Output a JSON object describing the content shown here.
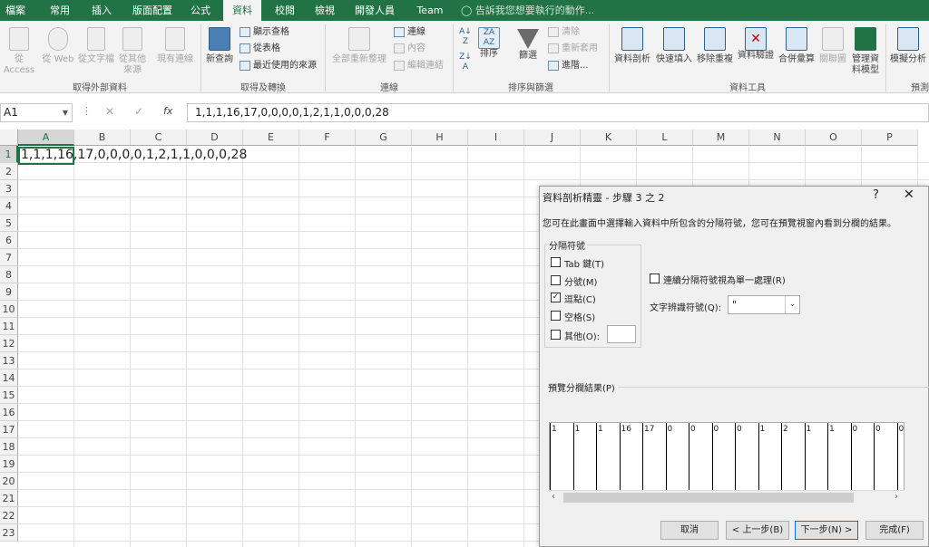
{
  "tabs": [
    "檔案",
    "常用",
    "插入",
    "版面配置",
    "公式",
    "資料",
    "校閱",
    "檢視",
    "開發人員",
    "Team"
  ],
  "active_tab": "資料",
  "tell_me": "告訴我您想要執行的動作...",
  "ribbon": {
    "group_external": {
      "label": "取得外部資料",
      "buttons": [
        "從 Access",
        "從 Web",
        "從文字檔",
        "從其他來源",
        "現有連線"
      ]
    },
    "group_transform": {
      "label": "取得及轉換",
      "new_query": "新查詢",
      "small": [
        "顯示查格",
        "從表格",
        "最近使用的來源"
      ]
    },
    "group_connections": {
      "label": "連線",
      "refresh_all": "全部重新整理",
      "small": [
        "連線",
        "內容",
        "編輯連結"
      ]
    },
    "group_sort": {
      "label": "排序與篩選",
      "sort": "排序",
      "filter": "篩選",
      "small": [
        "清除",
        "重新套用",
        "進階..."
      ]
    },
    "group_tools": {
      "label": "資料工具",
      "buttons": [
        "資料剖析",
        "快速填入",
        "移除重複",
        "資料驗證",
        "合併彙算",
        "關聯圖",
        "管理資料模型"
      ]
    },
    "group_forecast": {
      "label": "預測",
      "buttons": [
        "模擬分析"
      ]
    }
  },
  "formula_bar": {
    "name_box": "A1",
    "fx": "fx",
    "formula": "1,1,1,16,17,0,0,0,0,1,2,1,1,0,0,0,28"
  },
  "columns": [
    "A",
    "B",
    "C",
    "D",
    "E",
    "F",
    "G",
    "H",
    "I",
    "J",
    "K",
    "L",
    "M",
    "N",
    "O",
    "P"
  ],
  "rows": [
    "1",
    "2",
    "3",
    "4",
    "5",
    "6",
    "7",
    "8",
    "9",
    "10",
    "11",
    "12",
    "13",
    "14",
    "15",
    "16",
    "17",
    "18",
    "19",
    "20",
    "21",
    "22",
    "23"
  ],
  "cell_a1": "1,1,1,16,17,0,0,0,0,1,2,1,1,0,0,0,28",
  "dialog": {
    "title": "資料剖析精靈 - 步驟 3 之 2",
    "help": "?",
    "close": "✕",
    "description": "您可在此畫面中選擇輸入資料中所包含的分隔符號，您可在預覽視窗內看到分欄的結果。",
    "delimiters_label": "分隔符號",
    "delimiters": [
      {
        "label": "Tab 鍵(T)",
        "checked": false
      },
      {
        "label": "分號(M)",
        "checked": false
      },
      {
        "label": "逗點(C)",
        "checked": true
      },
      {
        "label": "空格(S)",
        "checked": false
      },
      {
        "label": "其他(O):",
        "checked": false
      }
    ],
    "consecutive": "連續分隔符號視為單一處理(R)",
    "qualifier_label": "文字辨識符號(Q):",
    "qualifier_value": "\"",
    "preview_label": "預覽分欄結果(P)",
    "preview_values": [
      "1",
      "1",
      "1",
      "16",
      "17",
      "0",
      "0",
      "0",
      "0",
      "1",
      "2",
      "1",
      "1",
      "0",
      "0",
      "0"
    ],
    "buttons": {
      "cancel": "取消",
      "back": "< 上一步(B)",
      "next": "下一步(N) >",
      "finish": "完成(F)"
    }
  }
}
